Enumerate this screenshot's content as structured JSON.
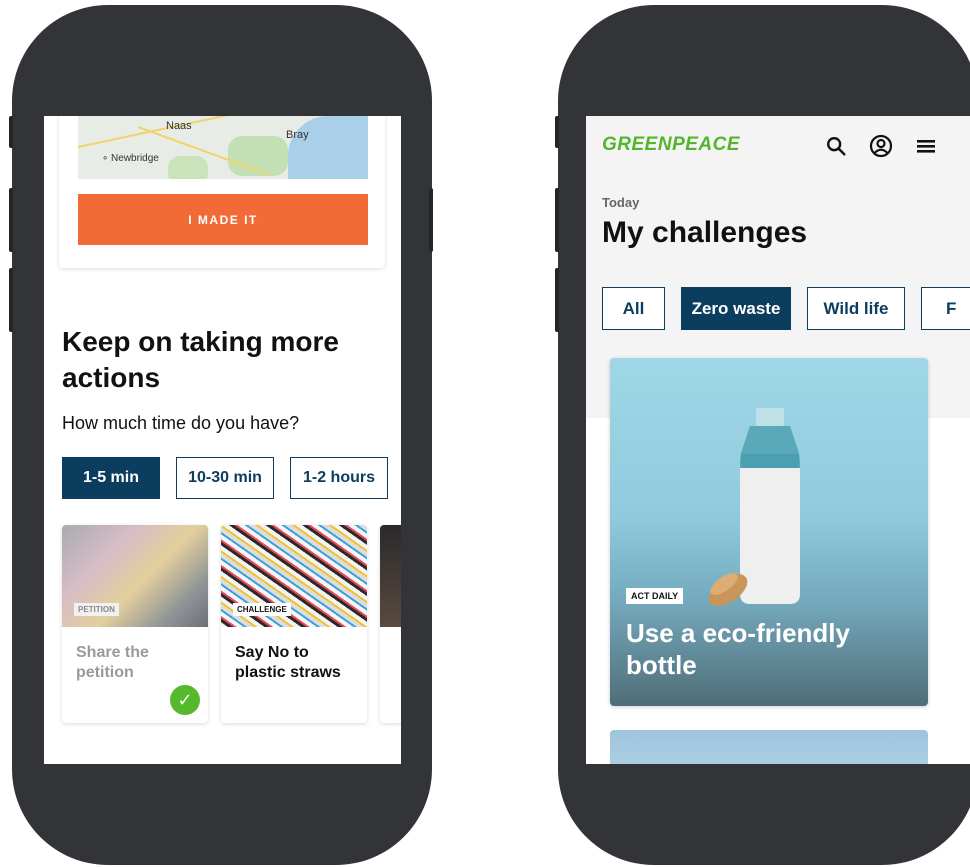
{
  "left_screen": {
    "map": {
      "labels": [
        "Naas",
        "Bray",
        "Newbridge"
      ]
    },
    "made_it_button": "I MADE IT",
    "section_title": "Keep on taking more actions",
    "time_question": "How much time do you have?",
    "time_options": [
      {
        "label": "1-5 min",
        "active": true
      },
      {
        "label": "10-30 min",
        "active": false
      },
      {
        "label": "1-2 hours",
        "active": false
      }
    ],
    "action_cards": [
      {
        "tag": "PETITION",
        "title": "Share the petition",
        "completed": true
      },
      {
        "tag": "CHALLENGE",
        "title": "Say No to plastic straws",
        "completed": false
      },
      {
        "tag": "",
        "title": "",
        "completed": false
      }
    ]
  },
  "right_screen": {
    "logo": "GREENPEACE",
    "header_icons": [
      "search-icon",
      "account-icon",
      "menu-icon"
    ],
    "date_label": "Today",
    "page_title": "My challenges",
    "filters": [
      {
        "label": "All",
        "active": false
      },
      {
        "label": "Zero waste",
        "active": true
      },
      {
        "label": "Wild life",
        "active": false
      },
      {
        "label": "F",
        "active": false
      }
    ],
    "hero_card": {
      "tag": "ACT DAILY",
      "title": "Use a eco-friendly bottle"
    }
  },
  "colors": {
    "primary_navy": "#0b3d5e",
    "accent_orange": "#f26b37",
    "greenpeace_green": "#53b52c",
    "check_green": "#56b92b",
    "phone_frame": "#333438"
  }
}
